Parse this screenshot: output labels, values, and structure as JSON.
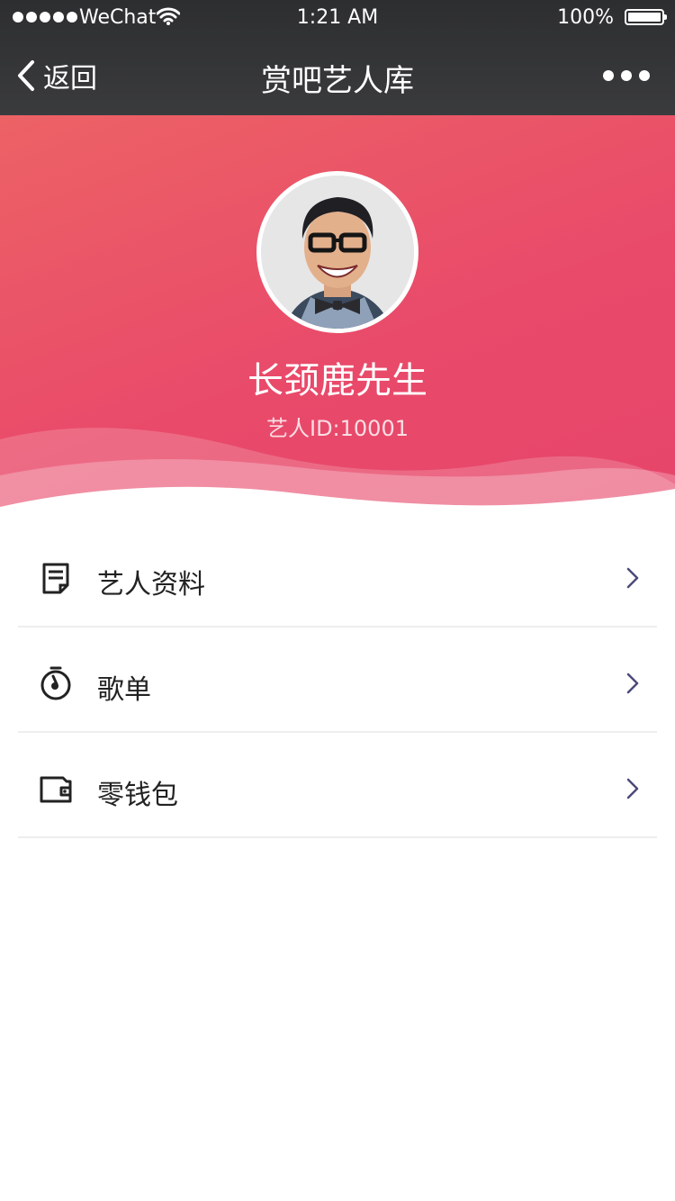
{
  "status_bar": {
    "carrier": "WeChat",
    "time": "1:21 AM",
    "battery": "100%"
  },
  "nav": {
    "back_label": "返回",
    "title": "赏吧艺人库"
  },
  "profile": {
    "name": "长颈鹿先生",
    "artist_id": "艺人ID:10001"
  },
  "menu": [
    {
      "label": "艺人资料",
      "icon": "document-icon"
    },
    {
      "label": "歌单",
      "icon": "music-timer-icon"
    },
    {
      "label": "零钱包",
      "icon": "wallet-icon"
    }
  ],
  "colors": {
    "nav_bg": "#2d2e30",
    "hero_start": "#ec6265",
    "hero_end": "#e6456b",
    "chevron": "#4b4a7a"
  }
}
